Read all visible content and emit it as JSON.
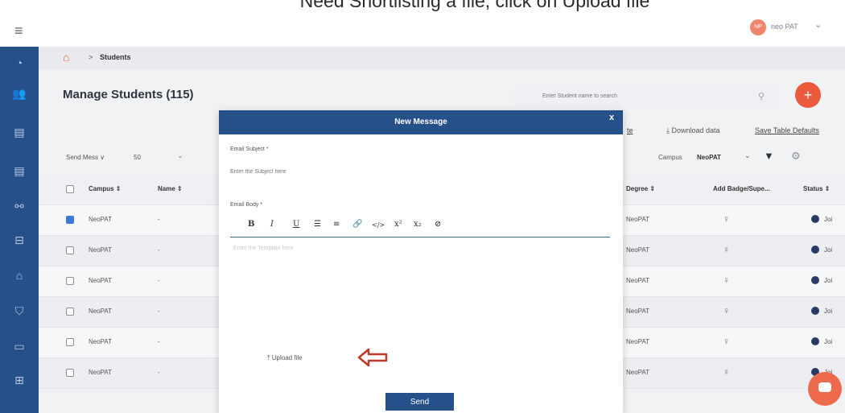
{
  "caption": "Need Shortlisting a file, click on Upload file",
  "topbar": {
    "user_initials": "NP",
    "user_name": "neo PAT"
  },
  "breadcrumb": {
    "separator": ">",
    "current": "Students"
  },
  "page": {
    "title": "Manage Students (115)"
  },
  "search": {
    "placeholder": "Enter Student name to search"
  },
  "toolbar": {
    "cut_label": "te",
    "download_label": "⤓ Download data",
    "save_defaults_label": "Save Table Defaults"
  },
  "controls": {
    "send_message_label": "Send Mess ∨",
    "per_page": "50",
    "campus_label": "Campus",
    "campus_value": "NeoPAT"
  },
  "table": {
    "headers": {
      "campus": "Campus ⇕",
      "name": "Name ⇕",
      "degree": "Degree ⇕",
      "badge": "Add Badge/Supe...",
      "status": "Status ⇕"
    },
    "rows": [
      {
        "campus": "NeoPAT",
        "name": "-",
        "degree": "NeoPAT",
        "status": "Joi",
        "checked": true
      },
      {
        "campus": "NeoPAT",
        "name": "-",
        "degree": "NeoPAT",
        "status": "Joi",
        "checked": false
      },
      {
        "campus": "NeoPAT",
        "name": "-",
        "degree": "NeoPAT",
        "status": "Joi",
        "checked": false
      },
      {
        "campus": "NeoPAT",
        "name": "-",
        "degree": "NeoPAT",
        "status": "Joi",
        "checked": false
      },
      {
        "campus": "NeoPAT",
        "name": "-",
        "degree": "NeoPAT",
        "status": "Joi",
        "checked": false
      },
      {
        "campus": "NeoPAT",
        "name": "-",
        "degree": "NeoPAT",
        "status": "Joi",
        "checked": false
      }
    ]
  },
  "modal": {
    "title": "New Message",
    "close": "x",
    "subject_label": "Email Subject *",
    "subject_placeholder": "Enter the Subject here",
    "body_label": "Email Body *",
    "body_placeholder": "Enter the Template here",
    "toolbar": [
      "B",
      "I",
      "U",
      "☰",
      "≡",
      "🔗",
      "</>",
      "x²",
      "x₂",
      "⊘"
    ],
    "upload_label": "⤒ Upload file",
    "send_label": "Send"
  },
  "colors": {
    "sidebar": "#26508a",
    "accent": "#ea5a3c",
    "status_dot": "#2a3a66"
  },
  "icons": [
    "menu-icon",
    "home-icon",
    "search-icon",
    "plus-icon",
    "filter-icon",
    "gear-icon",
    "badge-icon",
    "chat-icon"
  ]
}
